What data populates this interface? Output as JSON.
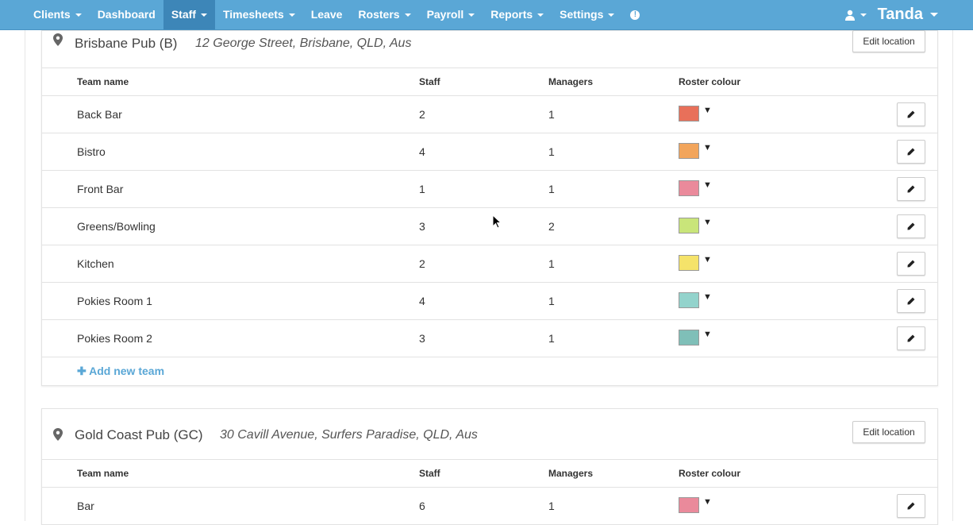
{
  "nav": {
    "items": [
      {
        "label": "Clients",
        "dropdown": true,
        "active": false
      },
      {
        "label": "Dashboard",
        "dropdown": false,
        "active": false
      },
      {
        "label": "Staff",
        "dropdown": true,
        "active": true
      },
      {
        "label": "Timesheets",
        "dropdown": true,
        "active": false
      },
      {
        "label": "Leave",
        "dropdown": false,
        "active": false
      },
      {
        "label": "Rosters",
        "dropdown": true,
        "active": false
      },
      {
        "label": "Payroll",
        "dropdown": true,
        "active": false
      },
      {
        "label": "Reports",
        "dropdown": true,
        "active": false
      },
      {
        "label": "Settings",
        "dropdown": true,
        "active": false
      }
    ],
    "help_glyph": "!",
    "brand": "Tanda"
  },
  "columns": {
    "team_name": "Team name",
    "staff": "Staff",
    "managers": "Managers",
    "roster_colour": "Roster colour"
  },
  "locations": [
    {
      "name": "Brisbane Pub (B)",
      "address": "12 George Street, Brisbane, QLD, Aus",
      "edit_label": "Edit location",
      "add_team_label": "Add new team",
      "teams": [
        {
          "name": "Back Bar",
          "staff": "2",
          "managers": "1",
          "colour": "#e8705a"
        },
        {
          "name": "Bistro",
          "staff": "4",
          "managers": "1",
          "colour": "#f2a55c"
        },
        {
          "name": "Front Bar",
          "staff": "1",
          "managers": "1",
          "colour": "#ea8a9b"
        },
        {
          "name": "Greens/Bowling",
          "staff": "3",
          "managers": "2",
          "colour": "#c9e57a"
        },
        {
          "name": "Kitchen",
          "staff": "2",
          "managers": "1",
          "colour": "#f5e36a"
        },
        {
          "name": "Pokies Room 1",
          "staff": "4",
          "managers": "1",
          "colour": "#93d3cc"
        },
        {
          "name": "Pokies Room 2",
          "staff": "3",
          "managers": "1",
          "colour": "#7fbfb8"
        }
      ]
    },
    {
      "name": "Gold Coast Pub (GC)",
      "address": "30 Cavill Avenue, Surfers Paradise, QLD, Aus",
      "edit_label": "Edit location",
      "teams": [
        {
          "name": "Bar",
          "staff": "6",
          "managers": "1",
          "colour": "#ea8a9b"
        }
      ]
    }
  ],
  "colors": {
    "nav_bg": "#5aa7d6",
    "nav_active": "#3d86b8",
    "link": "#5aa7d6"
  }
}
